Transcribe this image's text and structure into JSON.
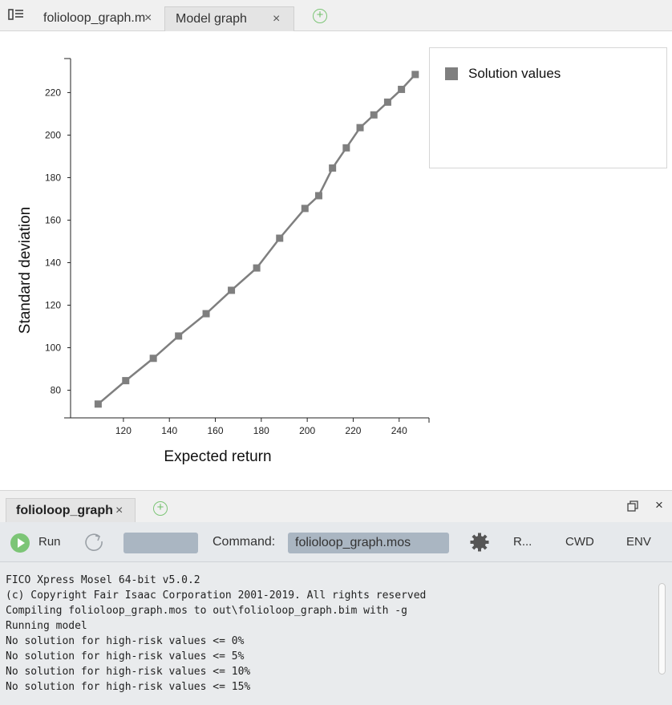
{
  "tabs": [
    {
      "label": "folioloop_graph.m",
      "active": false
    },
    {
      "label": "Model graph",
      "active": true
    }
  ],
  "chart_data": {
    "type": "line",
    "xlabel": "Expected return",
    "ylabel": "Standard deviation",
    "xlim": [
      97,
      253
    ],
    "ylim": [
      67,
      236
    ],
    "xticks": [
      120,
      140,
      160,
      180,
      200,
      220,
      240
    ],
    "yticks": [
      80,
      100,
      120,
      140,
      160,
      180,
      200,
      220
    ],
    "legend_position": "right",
    "grid": false,
    "series": [
      {
        "name": "Solution values",
        "color": "#7f7f7f",
        "x": [
          109,
          121,
          133,
          144,
          156,
          167,
          178,
          188,
          199,
          205,
          211,
          217,
          223,
          229,
          235,
          241,
          247
        ],
        "y": [
          73.5,
          84.5,
          95,
          105.5,
          116,
          127,
          137.5,
          151.5,
          165.5,
          171.5,
          184.5,
          194,
          203.5,
          209.5,
          215.5,
          221.5,
          228.5
        ]
      }
    ]
  },
  "bottom_panel": {
    "tab_label": "folioloop_graph",
    "run_label": "Run",
    "command_label": "Command:",
    "command_value": "folioloop_graph.mos",
    "r_label": "R...",
    "cwd_label": "CWD",
    "env_label": "ENV",
    "console_lines": [
      "FICO Xpress Mosel 64-bit v5.0.2",
      "(c) Copyright Fair Isaac Corporation 2001-2019. All rights reserved",
      "Compiling folioloop_graph.mos to out\\folioloop_graph.bim with -g",
      "Running model",
      "No solution for high-risk values <= 0%",
      "No solution for high-risk values <= 5%",
      "No solution for high-risk values <= 10%",
      "No solution for high-risk values <= 15%"
    ]
  }
}
